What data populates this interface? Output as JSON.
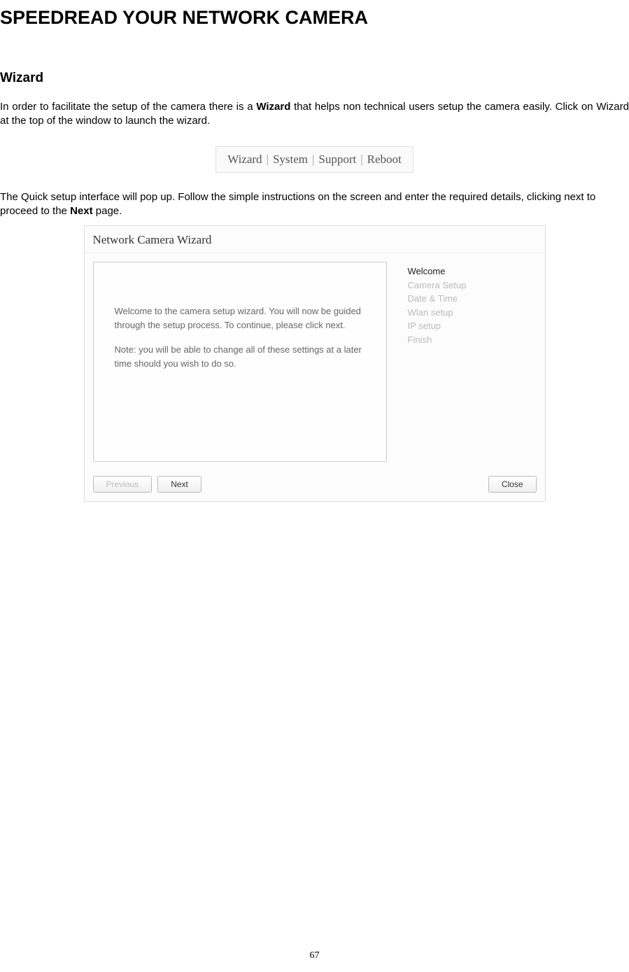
{
  "title": "SPEEDREAD YOUR NETWORK CAMERA",
  "section": "Wizard",
  "para1_pre": "In order to facilitate the setup of the camera there is a ",
  "para1_bold": "Wizard",
  "para1_post": " that helps non technical users setup the camera easily. Click on Wizard at the top of the window to launch the wizard.",
  "nav": {
    "items": [
      "Wizard",
      "System",
      "Support",
      "Reboot"
    ],
    "sep": "|"
  },
  "para2_pre": "The Quick setup interface will pop up. Follow the simple instructions on the screen and enter the required details, clicking next to proceed to the ",
  "para2_bold": "Next",
  "para2_post": " page.",
  "wizard": {
    "title": "Network Camera Wizard",
    "content_p1": "Welcome to the camera setup wizard. You will now be guided through the setup process. To continue, please click next.",
    "content_p2": "Note: you will be able to change all of these settings at a later time should you wish to do so.",
    "steps": [
      {
        "label": "Welcome",
        "active": true
      },
      {
        "label": "Camera Setup",
        "active": false
      },
      {
        "label": "Date & Time",
        "active": false
      },
      {
        "label": "Wlan setup",
        "active": false
      },
      {
        "label": "IP setup",
        "active": false
      },
      {
        "label": "Finish",
        "active": false
      }
    ],
    "buttons": {
      "previous": "Previous",
      "next": "Next",
      "close": "Close"
    }
  },
  "page_number": "67"
}
